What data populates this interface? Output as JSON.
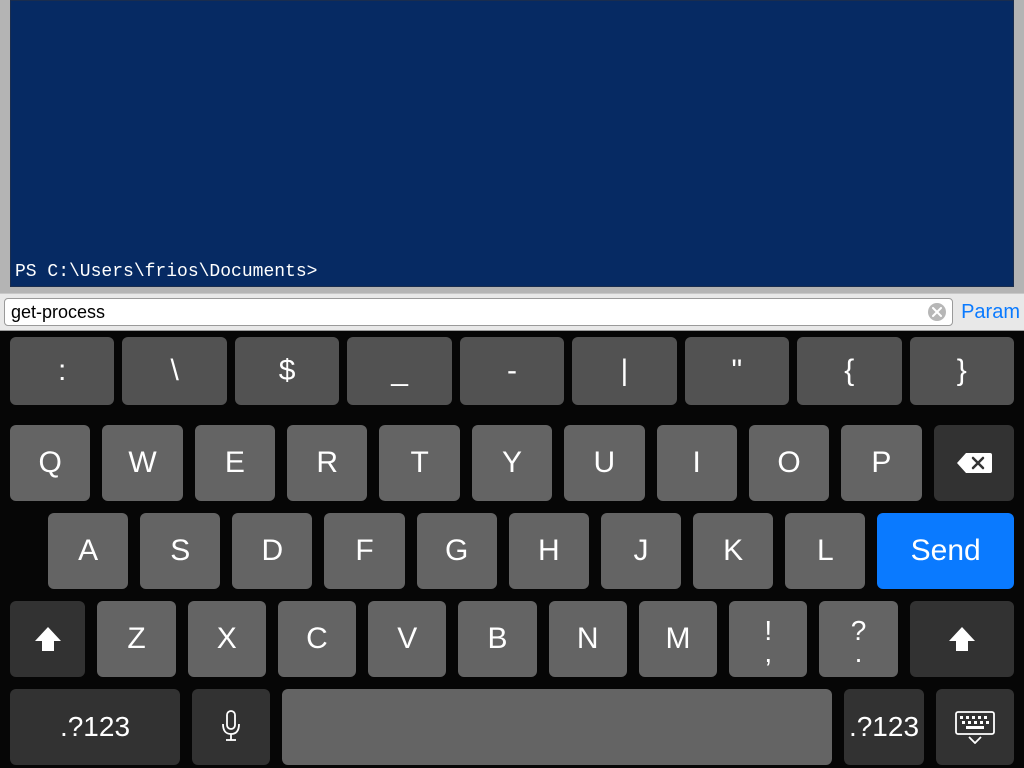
{
  "terminal": {
    "prompt": "PS C:\\Users\\frios\\Documents>"
  },
  "input_bar": {
    "value": "get-process",
    "param_label": "Param"
  },
  "keyboard": {
    "symbol_row": [
      ":",
      "\\",
      "$",
      "_",
      "-",
      "|",
      "\"",
      "{",
      "}"
    ],
    "row_q": [
      "Q",
      "W",
      "E",
      "R",
      "T",
      "Y",
      "U",
      "I",
      "O",
      "P"
    ],
    "row_a": [
      "A",
      "S",
      "D",
      "F",
      "G",
      "H",
      "J",
      "K",
      "L"
    ],
    "send_label": "Send",
    "row_z": [
      "Z",
      "X",
      "C",
      "V",
      "B",
      "N",
      "M"
    ],
    "punct1_top": "!",
    "punct1_bottom": ",",
    "punct2_top": "?",
    "punct2_bottom": ".",
    "numlock_label": ".?123"
  }
}
